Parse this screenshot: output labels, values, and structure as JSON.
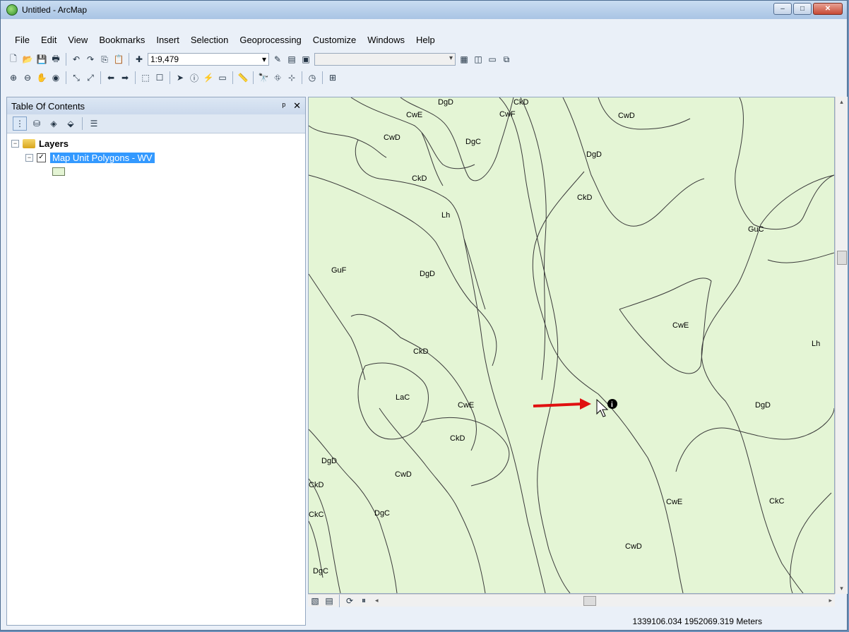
{
  "window": {
    "title": "Untitled - ArcMap",
    "min": "–",
    "max": "□",
    "close": "✕"
  },
  "menus": [
    "File",
    "Edit",
    "View",
    "Bookmarks",
    "Insert",
    "Selection",
    "Geoprocessing",
    "Customize",
    "Windows",
    "Help"
  ],
  "toolbar": {
    "scale": "1:9,479"
  },
  "toc": {
    "title": "Table Of Contents",
    "pin": "ᵖ",
    "close": "✕",
    "root": "Layers",
    "layer": "Map Unit Polygons - WV"
  },
  "map": {
    "labels": [
      "CkD",
      "CwE",
      "CwF",
      "DgD",
      "DgC",
      "CwD",
      "CkD",
      "CwD",
      "DgD",
      "Lh",
      "CkD",
      "GuC",
      "GuF",
      "DgD",
      "CwE",
      "CkD",
      "Lh",
      "LaC",
      "CwE",
      "CkD",
      "DgD",
      "DgD",
      "CkD",
      "CwD",
      "CkC",
      "DgC",
      "CwE",
      "CkC",
      "CwD",
      "DgC"
    ],
    "fill": "#e4f5d5",
    "line": "#3a3a3a"
  },
  "status": {
    "coords": "1339106.034  1952069.319 Meters"
  }
}
